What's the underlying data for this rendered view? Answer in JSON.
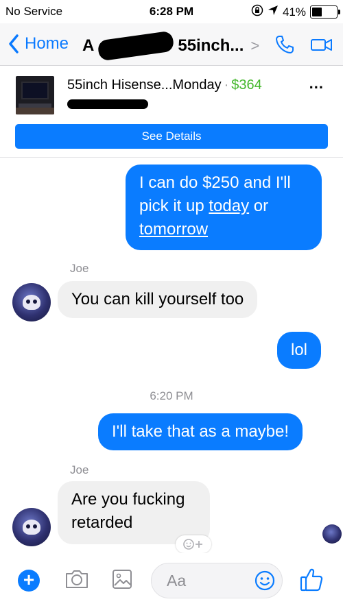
{
  "status": {
    "carrier": "No Service",
    "time": "6:28 PM",
    "battery": "41%",
    "battery_level": 0.41
  },
  "nav": {
    "back_label": "Home",
    "title_prefix": "A",
    "title_suffix": "55inch...",
    "chevron": ">"
  },
  "product": {
    "title": "55inch Hisense...Monday",
    "dot": "·",
    "price": "$364",
    "more": "...",
    "button": "See Details"
  },
  "messages": {
    "m1_part1": "I can do $250 and I'll pick it up ",
    "m1_today": "today",
    "m1_or": " or",
    "m1_tomorrow": "tomorrow",
    "sender1": "Joe",
    "m2": "You can kill yourself too",
    "m3": "lol",
    "timestamp": "6:20 PM",
    "m4": "I'll take that as a maybe!",
    "sender2": "Joe",
    "m5_line1": "Are you fucking",
    "m5_line2": "retarded"
  },
  "composer": {
    "placeholder": "Aa",
    "plus": "+"
  },
  "colors": {
    "accent": "#0a7cff",
    "price": "#42b72a",
    "incoming": "#f0f0f0"
  }
}
